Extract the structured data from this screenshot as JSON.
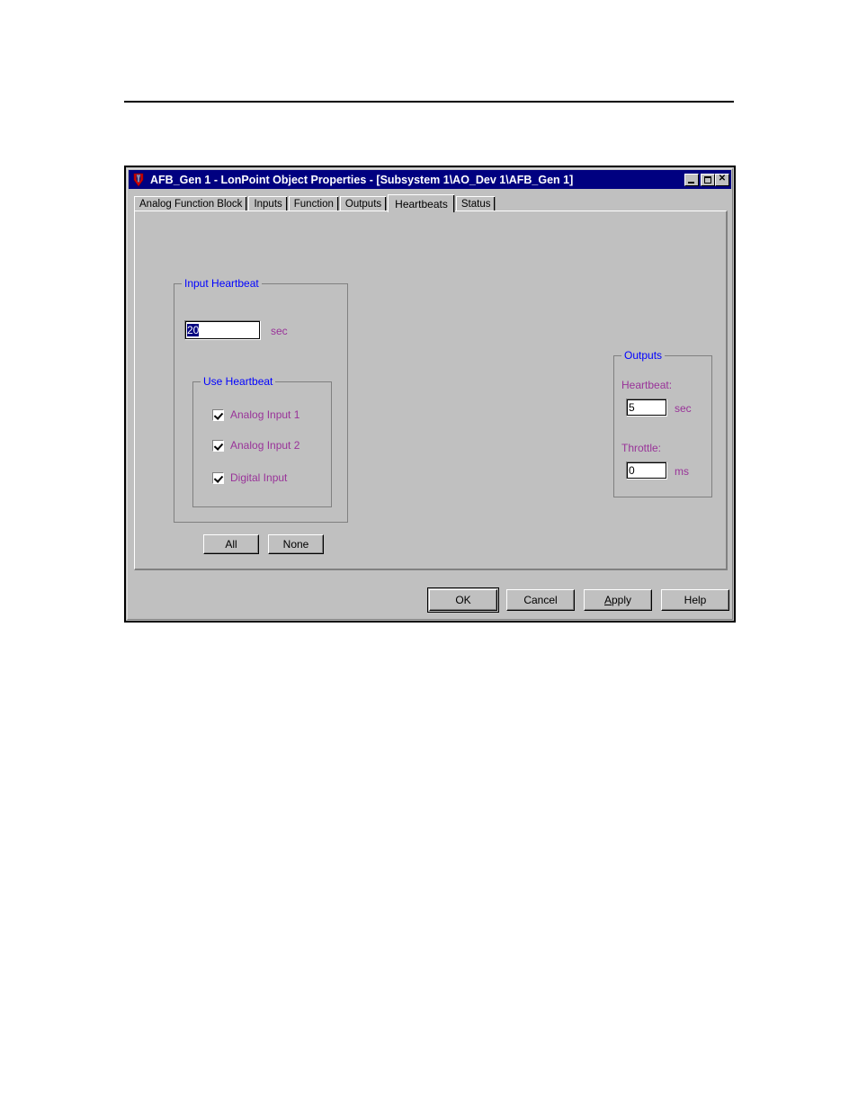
{
  "window": {
    "title": "AFB_Gen 1 - LonPoint Object Properties - [Subsystem 1\\AO_Dev 1\\AFB_Gen 1]",
    "icon": "lonpoint-app-icon",
    "controls": {
      "minimize": "_",
      "maximize": "□",
      "close": "✕"
    },
    "titlebar_color": "#000080",
    "face_color": "#c0c0c0"
  },
  "tabs": [
    {
      "label": "Analog Function Block",
      "active": false
    },
    {
      "label": "Inputs",
      "active": false
    },
    {
      "label": "Function",
      "active": false
    },
    {
      "label": "Outputs",
      "active": false
    },
    {
      "label": "Heartbeats",
      "active": true
    },
    {
      "label": "Status",
      "active": false
    }
  ],
  "colors": {
    "group_title": "#0000ff",
    "field_label": "#993399",
    "selection": "#000080"
  },
  "input_heartbeat": {
    "group_title": "Input Heartbeat",
    "value": "20",
    "value_selected": true,
    "unit": "sec",
    "use_heartbeat": {
      "group_title": "Use Heartbeat",
      "items": [
        {
          "label": "Analog Input 1",
          "checked": true
        },
        {
          "label": "Analog Input 2",
          "checked": true
        },
        {
          "label": "Digital Input",
          "checked": true
        }
      ],
      "all_button": "All",
      "none_button": "None"
    }
  },
  "outputs": {
    "group_title": "Outputs",
    "heartbeat_label": "Heartbeat:",
    "heartbeat_value": "5",
    "heartbeat_unit": "sec",
    "throttle_label": "Throttle:",
    "throttle_value": "0",
    "throttle_unit": "ms"
  },
  "actions": {
    "ok": "OK",
    "cancel": "Cancel",
    "apply_prefix": "A",
    "apply_suffix": "pply",
    "help": "Help"
  }
}
